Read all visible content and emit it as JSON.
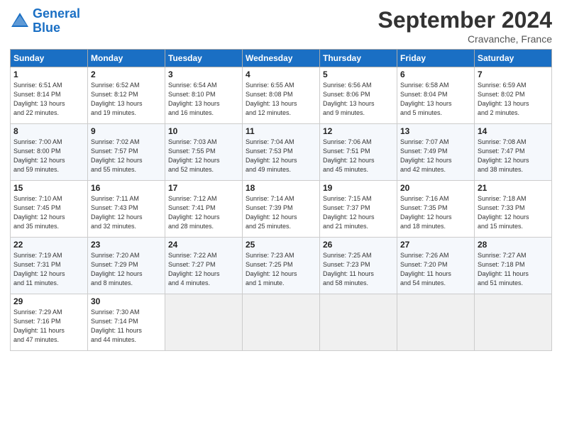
{
  "logo": {
    "line1": "General",
    "line2": "Blue"
  },
  "title": "September 2024",
  "location": "Cravanche, France",
  "days_of_week": [
    "Sunday",
    "Monday",
    "Tuesday",
    "Wednesday",
    "Thursday",
    "Friday",
    "Saturday"
  ],
  "weeks": [
    [
      {
        "day": "1",
        "info": "Sunrise: 6:51 AM\nSunset: 8:14 PM\nDaylight: 13 hours\nand 22 minutes."
      },
      {
        "day": "2",
        "info": "Sunrise: 6:52 AM\nSunset: 8:12 PM\nDaylight: 13 hours\nand 19 minutes."
      },
      {
        "day": "3",
        "info": "Sunrise: 6:54 AM\nSunset: 8:10 PM\nDaylight: 13 hours\nand 16 minutes."
      },
      {
        "day": "4",
        "info": "Sunrise: 6:55 AM\nSunset: 8:08 PM\nDaylight: 13 hours\nand 12 minutes."
      },
      {
        "day": "5",
        "info": "Sunrise: 6:56 AM\nSunset: 8:06 PM\nDaylight: 13 hours\nand 9 minutes."
      },
      {
        "day": "6",
        "info": "Sunrise: 6:58 AM\nSunset: 8:04 PM\nDaylight: 13 hours\nand 5 minutes."
      },
      {
        "day": "7",
        "info": "Sunrise: 6:59 AM\nSunset: 8:02 PM\nDaylight: 13 hours\nand 2 minutes."
      }
    ],
    [
      {
        "day": "8",
        "info": "Sunrise: 7:00 AM\nSunset: 8:00 PM\nDaylight: 12 hours\nand 59 minutes."
      },
      {
        "day": "9",
        "info": "Sunrise: 7:02 AM\nSunset: 7:57 PM\nDaylight: 12 hours\nand 55 minutes."
      },
      {
        "day": "10",
        "info": "Sunrise: 7:03 AM\nSunset: 7:55 PM\nDaylight: 12 hours\nand 52 minutes."
      },
      {
        "day": "11",
        "info": "Sunrise: 7:04 AM\nSunset: 7:53 PM\nDaylight: 12 hours\nand 49 minutes."
      },
      {
        "day": "12",
        "info": "Sunrise: 7:06 AM\nSunset: 7:51 PM\nDaylight: 12 hours\nand 45 minutes."
      },
      {
        "day": "13",
        "info": "Sunrise: 7:07 AM\nSunset: 7:49 PM\nDaylight: 12 hours\nand 42 minutes."
      },
      {
        "day": "14",
        "info": "Sunrise: 7:08 AM\nSunset: 7:47 PM\nDaylight: 12 hours\nand 38 minutes."
      }
    ],
    [
      {
        "day": "15",
        "info": "Sunrise: 7:10 AM\nSunset: 7:45 PM\nDaylight: 12 hours\nand 35 minutes."
      },
      {
        "day": "16",
        "info": "Sunrise: 7:11 AM\nSunset: 7:43 PM\nDaylight: 12 hours\nand 32 minutes."
      },
      {
        "day": "17",
        "info": "Sunrise: 7:12 AM\nSunset: 7:41 PM\nDaylight: 12 hours\nand 28 minutes."
      },
      {
        "day": "18",
        "info": "Sunrise: 7:14 AM\nSunset: 7:39 PM\nDaylight: 12 hours\nand 25 minutes."
      },
      {
        "day": "19",
        "info": "Sunrise: 7:15 AM\nSunset: 7:37 PM\nDaylight: 12 hours\nand 21 minutes."
      },
      {
        "day": "20",
        "info": "Sunrise: 7:16 AM\nSunset: 7:35 PM\nDaylight: 12 hours\nand 18 minutes."
      },
      {
        "day": "21",
        "info": "Sunrise: 7:18 AM\nSunset: 7:33 PM\nDaylight: 12 hours\nand 15 minutes."
      }
    ],
    [
      {
        "day": "22",
        "info": "Sunrise: 7:19 AM\nSunset: 7:31 PM\nDaylight: 12 hours\nand 11 minutes."
      },
      {
        "day": "23",
        "info": "Sunrise: 7:20 AM\nSunset: 7:29 PM\nDaylight: 12 hours\nand 8 minutes."
      },
      {
        "day": "24",
        "info": "Sunrise: 7:22 AM\nSunset: 7:27 PM\nDaylight: 12 hours\nand 4 minutes."
      },
      {
        "day": "25",
        "info": "Sunrise: 7:23 AM\nSunset: 7:25 PM\nDaylight: 12 hours\nand 1 minute."
      },
      {
        "day": "26",
        "info": "Sunrise: 7:25 AM\nSunset: 7:23 PM\nDaylight: 11 hours\nand 58 minutes."
      },
      {
        "day": "27",
        "info": "Sunrise: 7:26 AM\nSunset: 7:20 PM\nDaylight: 11 hours\nand 54 minutes."
      },
      {
        "day": "28",
        "info": "Sunrise: 7:27 AM\nSunset: 7:18 PM\nDaylight: 11 hours\nand 51 minutes."
      }
    ],
    [
      {
        "day": "29",
        "info": "Sunrise: 7:29 AM\nSunset: 7:16 PM\nDaylight: 11 hours\nand 47 minutes."
      },
      {
        "day": "30",
        "info": "Sunrise: 7:30 AM\nSunset: 7:14 PM\nDaylight: 11 hours\nand 44 minutes."
      },
      {
        "day": "",
        "info": ""
      },
      {
        "day": "",
        "info": ""
      },
      {
        "day": "",
        "info": ""
      },
      {
        "day": "",
        "info": ""
      },
      {
        "day": "",
        "info": ""
      }
    ]
  ]
}
